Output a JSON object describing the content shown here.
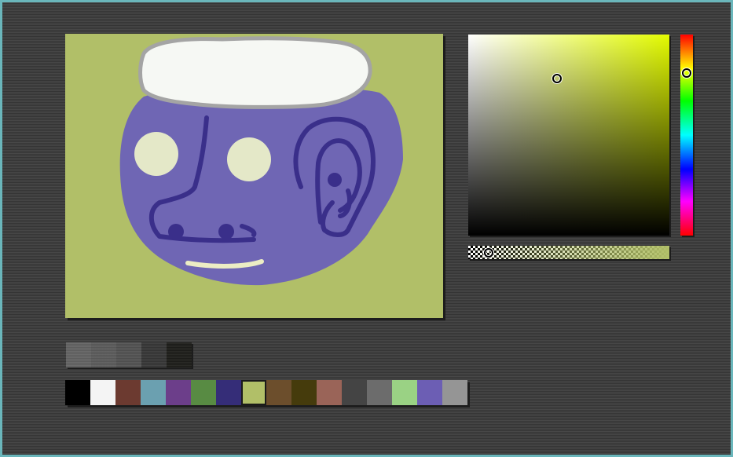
{
  "canvas": {
    "background": "#b1bf68",
    "face_color": "#6f66b4",
    "line_color": "#3a2f8a",
    "hat_color": "#f6f8f4",
    "hat_outline": "#a4a4a4",
    "eye_color": "#e4e8c8",
    "mouth_color": "#ecedc4"
  },
  "color_picker": {
    "hue_color": "#e3fb00",
    "saturation_value_position": {
      "saturation": 0.44,
      "value": 0.78
    },
    "hue_level": 0.19,
    "alpha_level": 0.1,
    "alpha_color": "#b1bf68"
  },
  "recent_colors": [
    "#636363",
    "#5b5b5b",
    "#525252",
    "#363636",
    "#1d1d19"
  ],
  "palette": {
    "selected_index": 7,
    "colors": [
      "#000000",
      "#f4f4f4",
      "#6c3a30",
      "#6ba0b0",
      "#6c3e8a",
      "#588b43",
      "#352d78",
      "#b1bf68",
      "#6c4e2c",
      "#453b0c",
      "#9a6458",
      "#444444",
      "#6c6c6c",
      "#9ad284",
      "#6c5eb4",
      "#959595"
    ]
  }
}
